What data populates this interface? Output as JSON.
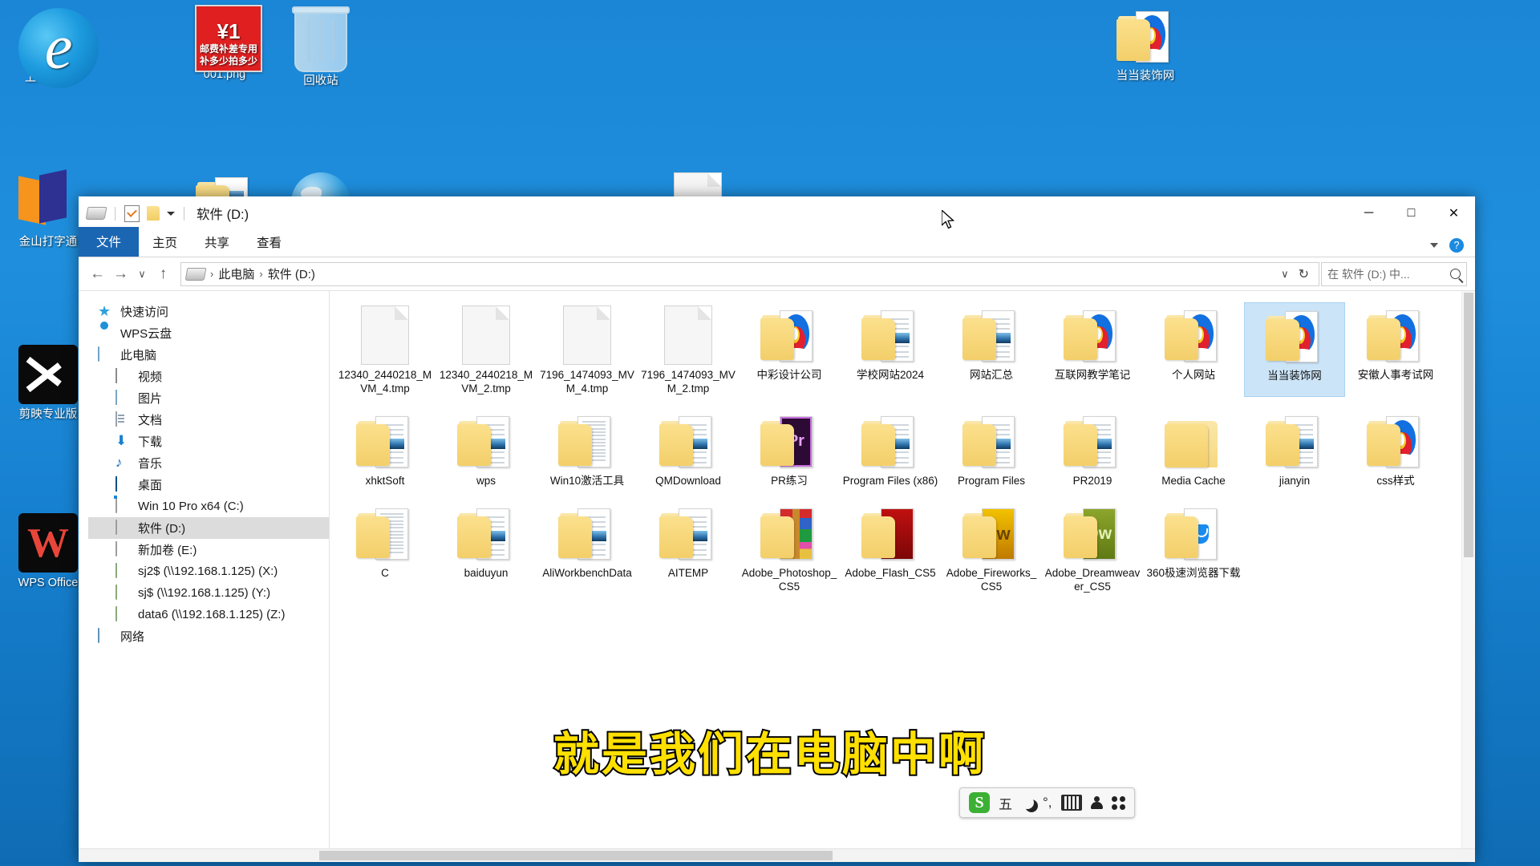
{
  "desktop": {
    "icons": [
      {
        "label": "上网导航",
        "icon": "edge-browser-icon"
      },
      {
        "label": "001.png",
        "icon": "image-thumbnail-icon",
        "badge_top": "¥1",
        "badge_l1": "邮费补差专用",
        "badge_l2": "补多少拍多少"
      },
      {
        "label": "回收站",
        "icon": "recycle-bin-icon"
      },
      {
        "label": "当当装饰网",
        "icon": "folder-icon"
      },
      {
        "label": "金山打字通",
        "icon": "kingsoft-typing-icon"
      },
      {
        "label": "剪映专业版",
        "icon": "jianying-icon"
      },
      {
        "label": "WPS Office",
        "icon": "wps-office-icon"
      }
    ]
  },
  "window": {
    "title": "软件 (D:)",
    "quick_access": [
      "drive-icon",
      "properties-icon",
      "new-folder-icon",
      "customize-dropdown-icon"
    ],
    "controls": {
      "minimize": "─",
      "maximize": "□",
      "close": "✕"
    },
    "ribbon_tabs": [
      {
        "label": "文件",
        "active": true
      },
      {
        "label": "主页",
        "active": false
      },
      {
        "label": "共享",
        "active": false
      },
      {
        "label": "查看",
        "active": false
      }
    ],
    "ribbon_help": "?"
  },
  "address": {
    "back": "←",
    "forward": "→",
    "recent": "∨",
    "up": "↑",
    "crumbs": [
      "此电脑",
      "软件 (D:)"
    ],
    "separator": "›",
    "dropdown": "∨",
    "refresh": "↻",
    "search_placeholder": "在 软件 (D:) 中..."
  },
  "sidebar": {
    "items": [
      {
        "label": "快速访问",
        "icon": "star-icon",
        "indent": false,
        "selected": false
      },
      {
        "label": "WPS云盘",
        "icon": "cloud-icon",
        "indent": false,
        "selected": false
      },
      {
        "label": "此电脑",
        "icon": "this-pc-icon",
        "indent": false,
        "selected": false
      },
      {
        "label": "视频",
        "icon": "videos-icon",
        "indent": true,
        "selected": false
      },
      {
        "label": "图片",
        "icon": "pictures-icon",
        "indent": true,
        "selected": false
      },
      {
        "label": "文档",
        "icon": "documents-icon",
        "indent": true,
        "selected": false
      },
      {
        "label": "下载",
        "icon": "downloads-icon",
        "indent": true,
        "selected": false
      },
      {
        "label": "音乐",
        "icon": "music-icon",
        "indent": true,
        "selected": false
      },
      {
        "label": "桌面",
        "icon": "desktop-icon",
        "indent": true,
        "selected": false
      },
      {
        "label": "Win 10 Pro x64 (C:)",
        "icon": "windows-drive-icon",
        "indent": true,
        "selected": false
      },
      {
        "label": "软件 (D:)",
        "icon": "drive-icon",
        "indent": true,
        "selected": true
      },
      {
        "label": "新加卷 (E:)",
        "icon": "drive-icon",
        "indent": true,
        "selected": false
      },
      {
        "label": "sj2$ (\\\\192.168.1.125) (X:)",
        "icon": "network-drive-icon",
        "indent": true,
        "selected": false
      },
      {
        "label": "sj$ (\\\\192.168.1.125) (Y:)",
        "icon": "network-drive-icon",
        "indent": true,
        "selected": false
      },
      {
        "label": "data6 (\\\\192.168.1.125) (Z:)",
        "icon": "network-drive-icon",
        "indent": true,
        "selected": false
      },
      {
        "label": "网络",
        "icon": "network-icon",
        "indent": false,
        "selected": false
      }
    ]
  },
  "files": [
    {
      "name": "12340_2440218_MVM_4.tmp",
      "type": "file",
      "selected": false
    },
    {
      "name": "12340_2440218_MVM_2.tmp",
      "type": "file",
      "selected": false
    },
    {
      "name": "7196_1474093_MVM_4.tmp",
      "type": "file",
      "selected": false
    },
    {
      "name": "7196_1474093_MVM_2.tmp",
      "type": "file",
      "selected": false
    },
    {
      "name": "中彩设计公司",
      "type": "folder-wave",
      "selected": false
    },
    {
      "name": "学校网站2024",
      "type": "folder-docs",
      "selected": false
    },
    {
      "name": "网站汇总",
      "type": "folder-docs",
      "selected": false
    },
    {
      "name": "互联网教学笔记",
      "type": "folder-wave",
      "selected": false
    },
    {
      "name": "个人网站",
      "type": "folder-wave",
      "selected": false
    },
    {
      "name": "当当装饰网",
      "type": "folder-wave",
      "selected": true
    },
    {
      "name": "安徽人事考试网",
      "type": "folder-wave",
      "selected": false
    },
    {
      "name": "xhktSoft",
      "type": "folder-docs",
      "selected": false
    },
    {
      "name": "wps",
      "type": "folder-docs",
      "selected": false
    },
    {
      "name": "Win10激活工具",
      "type": "folder-paper",
      "selected": false
    },
    {
      "name": "QMDownload",
      "type": "folder-docs",
      "selected": false
    },
    {
      "name": "PR练习",
      "type": "folder-pr",
      "selected": false
    },
    {
      "name": "Program Files (x86)",
      "type": "folder-docs",
      "selected": false
    },
    {
      "name": "Program Files",
      "type": "folder-docs",
      "selected": false
    },
    {
      "name": "PR2019",
      "type": "folder-docs",
      "selected": false
    },
    {
      "name": "Media Cache",
      "type": "folder-empty",
      "selected": false
    },
    {
      "name": "jianyin",
      "type": "folder-docs",
      "selected": false
    },
    {
      "name": "css样式",
      "type": "folder-wave",
      "selected": false
    },
    {
      "name": "C",
      "type": "folder-paper",
      "selected": false
    },
    {
      "name": "baiduyun",
      "type": "folder-docs",
      "selected": false
    },
    {
      "name": "AliWorkbenchData",
      "type": "folder-docs",
      "selected": false
    },
    {
      "name": "AITEMP",
      "type": "folder-docs",
      "selected": false
    },
    {
      "name": "Adobe_Photoshop_CS5",
      "type": "folder-ps",
      "selected": false
    },
    {
      "name": "Adobe_Flash_CS5",
      "type": "folder-fl",
      "selected": false
    },
    {
      "name": "Adobe_Fireworks_CS5",
      "type": "folder-fw",
      "selected": false
    },
    {
      "name": "Adobe_Dreamweaver_CS5",
      "type": "folder-dw",
      "selected": false
    },
    {
      "name": "360极速浏览器下载",
      "type": "folder-360",
      "selected": false
    }
  ],
  "subtitle": "就是我们在电脑中啊",
  "ime": {
    "logo": "S",
    "mode": "五",
    "items": [
      "moon-icon",
      "°,",
      "keyboard-icon",
      "person-icon",
      "apps-grid-icon"
    ]
  },
  "colors": {
    "accent": "#1b66b3",
    "selection": "#cce4f7",
    "desktop_blue": "#1b86d6",
    "subtitle_fill": "#ffe000"
  }
}
